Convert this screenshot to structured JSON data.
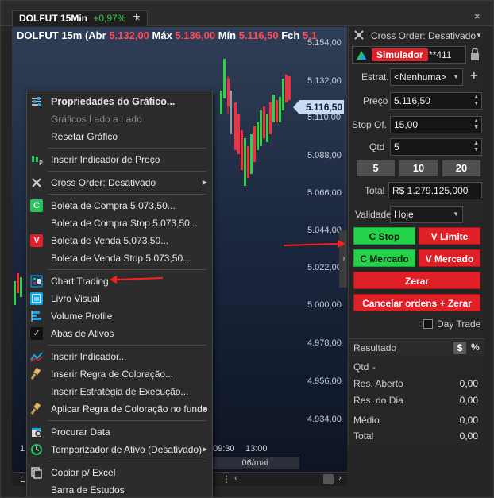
{
  "tab": {
    "symbol": "DOLFUT 15Min",
    "change": "+0,97%",
    "close": "×",
    "add": "+",
    "window_close": "×"
  },
  "chart": {
    "header_symbol": "DOLFUT 15m",
    "abr_label": "(Abr",
    "abr_value": "5.132,00",
    "max_label": "Máx",
    "max_value": "5.136,00",
    "min_label": "Mín",
    "min_value": "5.116,50",
    "fch_label": "Fch",
    "fch_value": "5.1",
    "price_labels": [
      "5.154,00",
      "5.132,00",
      "5.110,00",
      "5.088,00",
      "5.066,00",
      "5.044,00",
      "5.022,00",
      "5.000,00",
      "4.978,00",
      "4.956,00",
      "4.934,00"
    ],
    "current_price": "5.116,50",
    "time_labels": [
      "1",
      "09:30",
      "13:00"
    ],
    "date_label": "06/mai",
    "collapse": "›",
    "bottom_label": "L",
    "bottom_dots": "⋮",
    "bottom_chevron": "‹",
    "bottom_chevron_right": "›"
  },
  "context_menu": {
    "items": [
      {
        "label": "Propriedades do Gráfico...",
        "icon": "sliders-icon"
      },
      {
        "label": "Gráficos Lado a Lado",
        "icon": ""
      },
      {
        "label": "Resetar Gráfico",
        "icon": ""
      },
      {
        "label": "Inserir Indicador de Preço",
        "icon": "price-indicator-icon"
      },
      {
        "label": "Cross Order: Desativado",
        "icon": "cross-order-icon"
      },
      {
        "label": "Boleta de Compra  5.073,50...",
        "icon": "buy-icon"
      },
      {
        "label": "Boleta de Compra Stop  5.073,50...",
        "icon": ""
      },
      {
        "label": "Boleta de Venda   5.073,50...",
        "icon": "sell-icon"
      },
      {
        "label": "Boleta de Venda Stop   5.073,50...",
        "icon": ""
      },
      {
        "label": "Chart Trading",
        "icon": "chart-trading-icon"
      },
      {
        "label": "Livro Visual",
        "icon": "book-icon"
      },
      {
        "label": "Volume Profile",
        "icon": "volume-profile-icon"
      },
      {
        "label": "Abas de Ativos",
        "icon": "check-icon"
      },
      {
        "label": "Inserir Indicador...",
        "icon": "indicator-icon"
      },
      {
        "label": "Inserir Regra de Coloração...",
        "icon": "paint-icon"
      },
      {
        "label": "Inserir Estratégia de Execução...",
        "icon": ""
      },
      {
        "label": "Aplicar Regra de Coloração no fundo",
        "icon": "paint-bg-icon"
      },
      {
        "label": "Procurar Data",
        "icon": "search-date-icon"
      },
      {
        "label": "Temporizador de Ativo (Desativado)",
        "icon": "timer-icon"
      },
      {
        "label": "Copiar p/ Excel",
        "icon": "copy-icon"
      },
      {
        "label": "Barra de Estudos",
        "icon": ""
      }
    ],
    "icon_glyphs": {
      "buy": "C",
      "sell": "V",
      "check": "✓"
    }
  },
  "panel": {
    "cross_order_label": "Cross Order: Desativado",
    "account_label": "Simulador",
    "account_id": "**411",
    "estrat_label": "Estrat.",
    "estrat_value": "<Nenhuma>",
    "estrat_add": "+",
    "preco_label": "Preço",
    "preco_value": "5.116,50",
    "stop_label": "Stop Of.",
    "stop_value": "15,00",
    "qtd_label": "Qtd",
    "qtd_value": "5",
    "qty_buttons": [
      "5",
      "10",
      "20"
    ],
    "total_label": "Total",
    "total_value": "R$ 1.279.125,000",
    "validade_label": "Validade",
    "validade_value": "Hoje",
    "c_stop": "C Stop",
    "v_limite": "V Limite",
    "c_mercado": "C Mercado",
    "v_mercado": "V Mercado",
    "zerar": "Zerar",
    "cancelar_zerar": "Cancelar ordens + Zerar",
    "day_trade": "Day Trade",
    "resultado_label": "Resultado",
    "dollar_toggle": "$",
    "percent_toggle": "%",
    "qtd_res_label": "Qtd",
    "qtd_res_value": "-",
    "res_aberto_label": "Res. Aberto",
    "res_aberto_value": "0,00",
    "res_dia_label": "Res. do Dia",
    "res_dia_value": "0,00",
    "medio_label": "Médio",
    "medio_value": "0,00",
    "total_res_label": "Total",
    "total_res_value": "0,00"
  },
  "colors": {
    "up": "#31d04a",
    "down": "#ff2a3a",
    "accent_red": "#e01f27",
    "accent_green": "#22d34a"
  }
}
